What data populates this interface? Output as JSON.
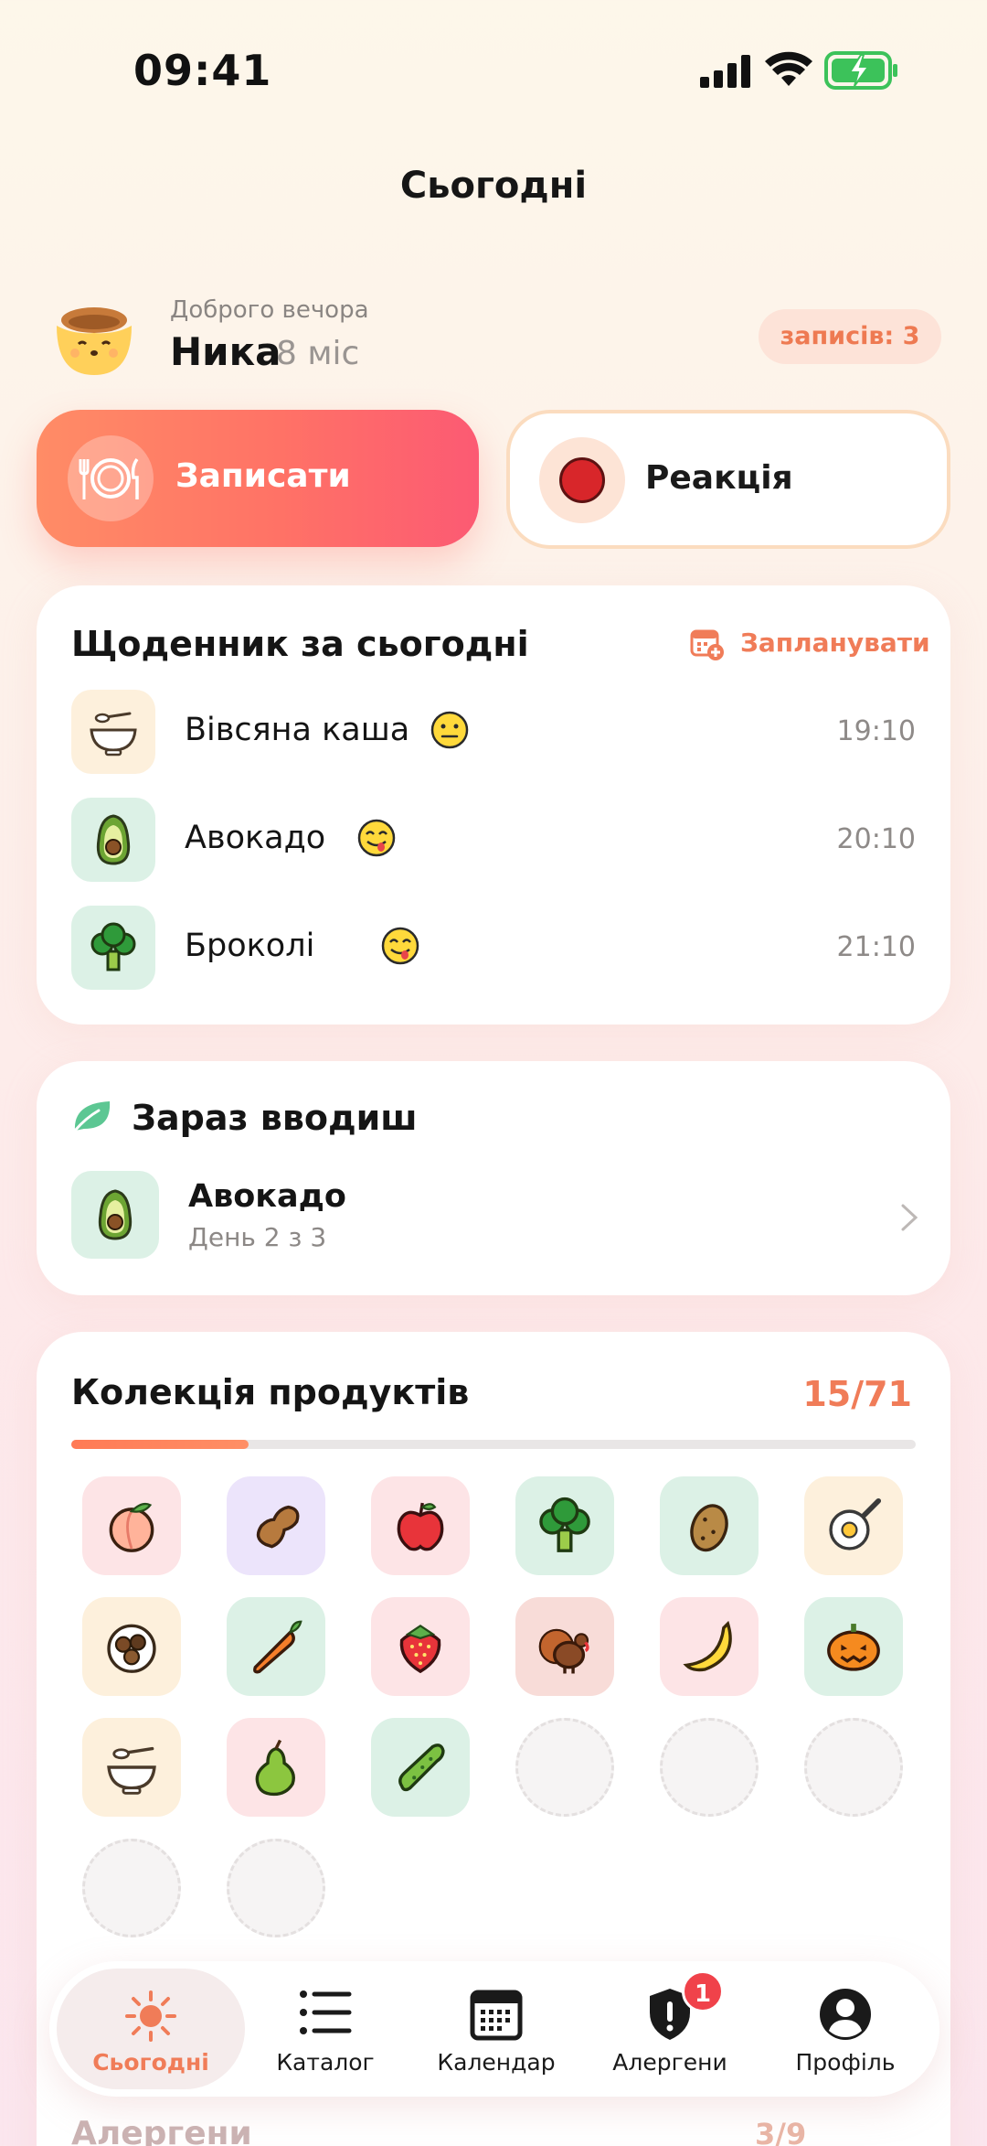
{
  "status_bar": {
    "time": "09:41"
  },
  "header": {
    "title": "Сьогодні"
  },
  "profile": {
    "greeting": "Доброго вечора",
    "name": "Ника",
    "age": "8 міс",
    "records_badge": "записів: 3"
  },
  "actions": {
    "record_label": "Записати",
    "reaction_label": "Реакція"
  },
  "diary": {
    "title": "Щоденник за сьогодні",
    "plan_label": "Запланувати",
    "items": [
      {
        "name": "Вівсяна каша",
        "time": "19:10",
        "icon": "porridge-bowl-icon",
        "reaction": "neutral-face"
      },
      {
        "name": "Авокадо",
        "time": "20:10",
        "icon": "avocado-icon",
        "reaction": "yum-face"
      },
      {
        "name": "Броколі",
        "time": "21:10",
        "icon": "broccoli-icon",
        "reaction": "yum-face"
      }
    ]
  },
  "introducing": {
    "title": "Зараз вводиш",
    "food": "Авокадо",
    "progress_text": "День 2 з 3"
  },
  "collection": {
    "title": "Колекція продуктів",
    "count": "15/71",
    "progress": 0.21,
    "items": [
      "peach-icon",
      "peanut-icon",
      "apple-icon",
      "broccoli-icon",
      "potato-icon",
      "egg-pan-icon",
      "beans-plate-icon",
      "carrot-icon",
      "strawberry-icon",
      "turkey-icon",
      "banana-icon",
      "pumpkin-icon",
      "porridge-bowl-icon",
      "pear-icon",
      "cucumber-icon",
      "empty",
      "empty",
      "empty",
      "empty",
      "empty"
    ]
  },
  "below": {
    "section": "Алергени",
    "count": "3/9"
  },
  "tab_bar": {
    "tabs": [
      {
        "label": "Сьогодні",
        "icon": "sun-icon",
        "active": true
      },
      {
        "label": "Каталог",
        "icon": "list-icon"
      },
      {
        "label": "Календар",
        "icon": "calendar-icon"
      },
      {
        "label": "Алергени",
        "icon": "shield-alert-icon",
        "badge": "1"
      },
      {
        "label": "Профіль",
        "icon": "user-icon"
      }
    ]
  },
  "colors": {
    "accent": "#f07c58",
    "danger": "#f0424a",
    "mint_tile": "#dcf1e6",
    "cream_tile": "#fdf0dc",
    "pink_tile": "#fde4e6"
  }
}
